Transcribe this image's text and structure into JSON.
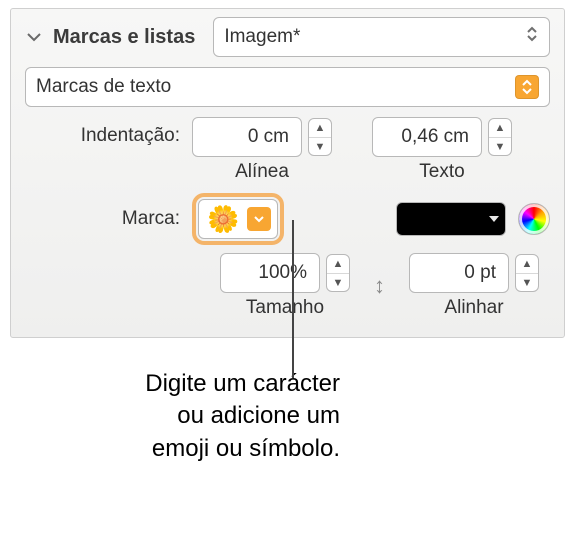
{
  "section": {
    "title": "Marcas e listas"
  },
  "style_popup": {
    "value": "Imagem*"
  },
  "type_popup": {
    "value": "Marcas de texto"
  },
  "indent": {
    "label": "Indentação:",
    "bullet": {
      "value": "0 cm",
      "sublabel": "Alínea"
    },
    "text": {
      "value": "0,46 cm",
      "sublabel": "Texto"
    }
  },
  "marca": {
    "label": "Marca:",
    "bullet_char": "🌼",
    "color": "#000000"
  },
  "size": {
    "value": "100%",
    "sublabel": "Tamanho"
  },
  "align": {
    "value": "0 pt",
    "sublabel": "Alinhar"
  },
  "callout": {
    "line1": "Digite um carácter",
    "line2": "ou adicione um",
    "line3": "emoji ou símbolo."
  }
}
